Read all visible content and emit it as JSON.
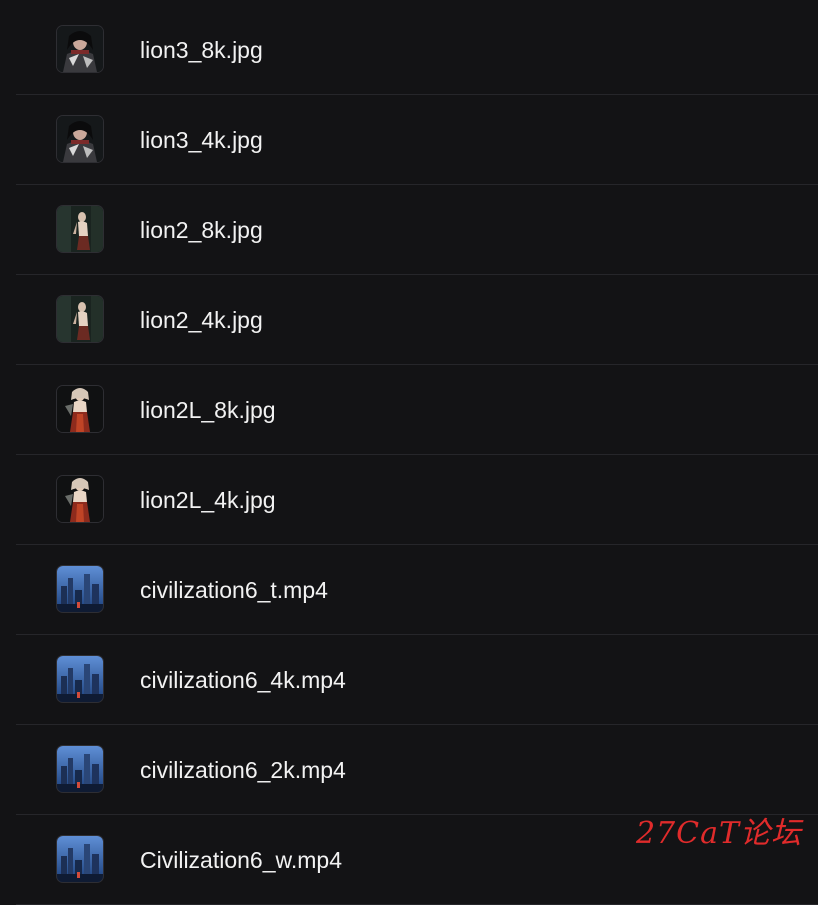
{
  "files": [
    {
      "name": "lion3_8k.jpg",
      "type": "image",
      "thumb": "portrait-dark-icon"
    },
    {
      "name": "lion3_4k.jpg",
      "type": "image",
      "thumb": "portrait-dark-icon"
    },
    {
      "name": "lion2_8k.jpg",
      "type": "image",
      "thumb": "portrait-figure-icon"
    },
    {
      "name": "lion2_4k.jpg",
      "type": "image",
      "thumb": "portrait-figure-icon"
    },
    {
      "name": "lion2L_8k.jpg",
      "type": "image",
      "thumb": "portrait-red-icon"
    },
    {
      "name": "lion2L_4k.jpg",
      "type": "image",
      "thumb": "portrait-red-icon"
    },
    {
      "name": "civilization6_t.mp4",
      "type": "video",
      "thumb": "city-blue-icon"
    },
    {
      "name": "civilization6_4k.mp4",
      "type": "video",
      "thumb": "city-blue-icon"
    },
    {
      "name": "civilization6_2k.mp4",
      "type": "video",
      "thumb": "city-blue-icon"
    },
    {
      "name": "Civilization6_w.mp4",
      "type": "video",
      "thumb": "city-blue-icon"
    }
  ],
  "watermark": "27CaT论坛",
  "colors": {
    "background": "#131315",
    "divider": "#26262a",
    "text": "#f2f2f2",
    "watermark": "#e02b2b"
  }
}
